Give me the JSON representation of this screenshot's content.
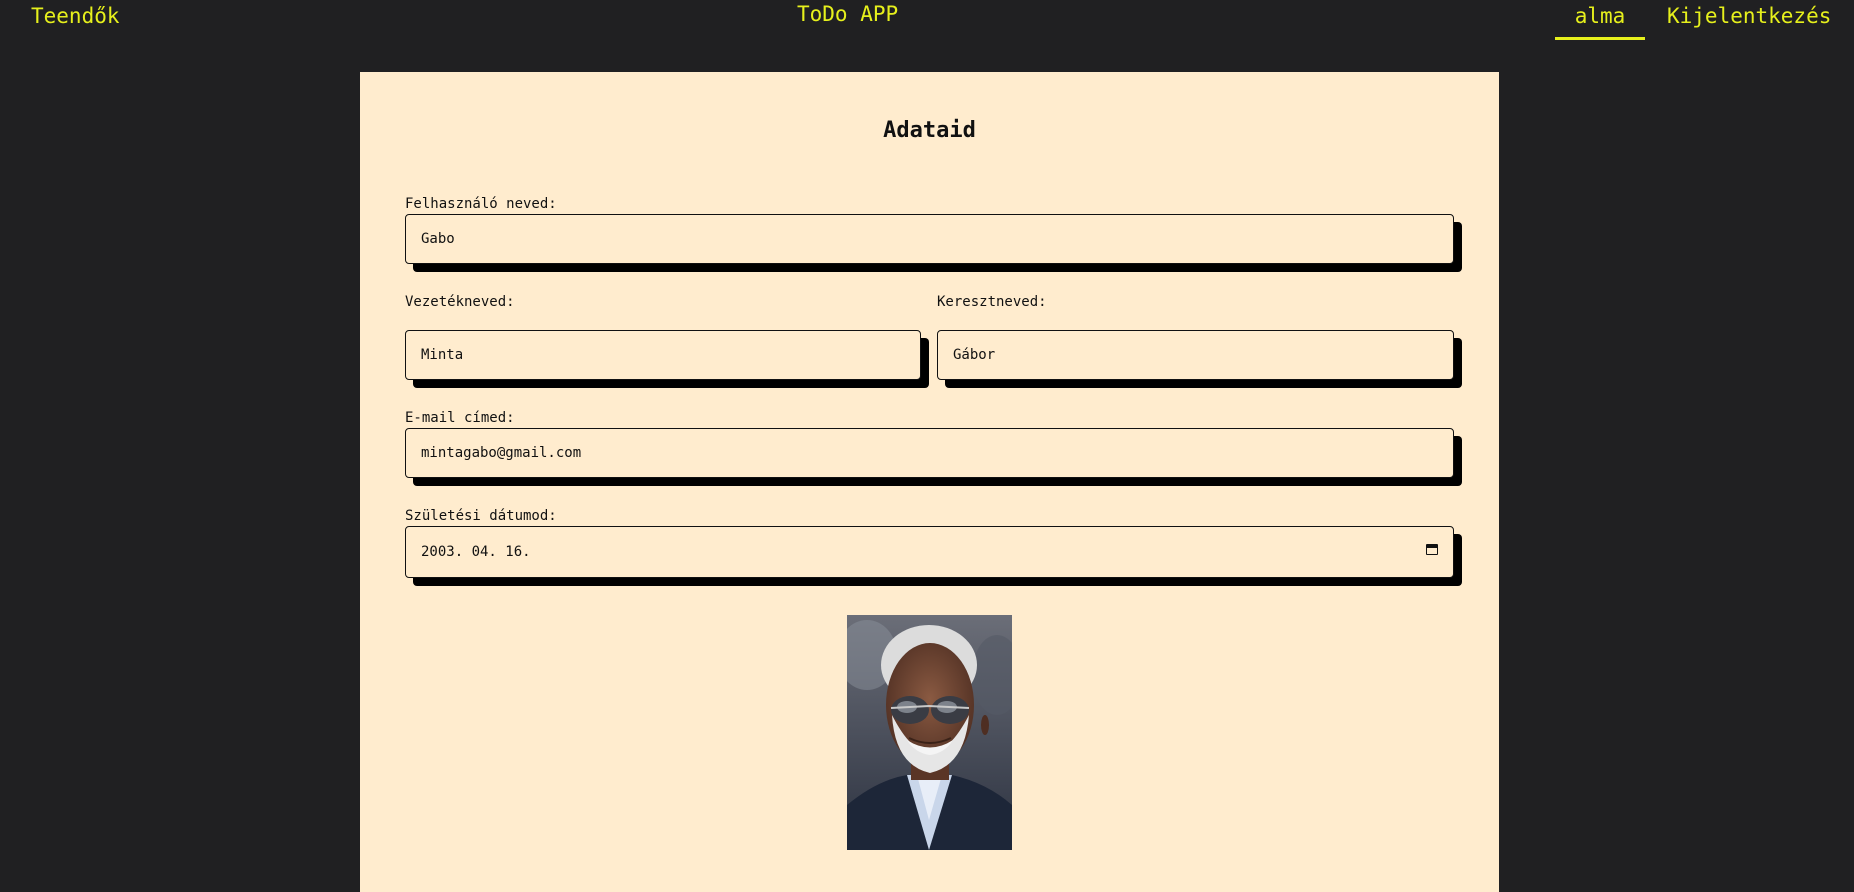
{
  "nav": {
    "left_link": "Teendők",
    "app_title": "ToDo APP",
    "user_link": "alma",
    "logout_link": "Kijelentkezés",
    "accent_color": "#e6f01c"
  },
  "profile": {
    "title": "Adataid",
    "username": {
      "label": "Felhasználó neved:",
      "value": "Gabo"
    },
    "lastname": {
      "label": "Vezetékneved:",
      "value": "Minta"
    },
    "firstname": {
      "label": "Keresztneved:",
      "value": "Gábor"
    },
    "email": {
      "label": "E-mail címed:",
      "value": "mintagabo@gmail.com"
    },
    "birthdate": {
      "label": "Születési dátumod:",
      "value": "2003. 04. 16.",
      "icon": "calendar-icon"
    },
    "photo": {
      "icon": "profile-photo"
    }
  },
  "colors": {
    "background": "#202022",
    "card": "#ffecce"
  }
}
